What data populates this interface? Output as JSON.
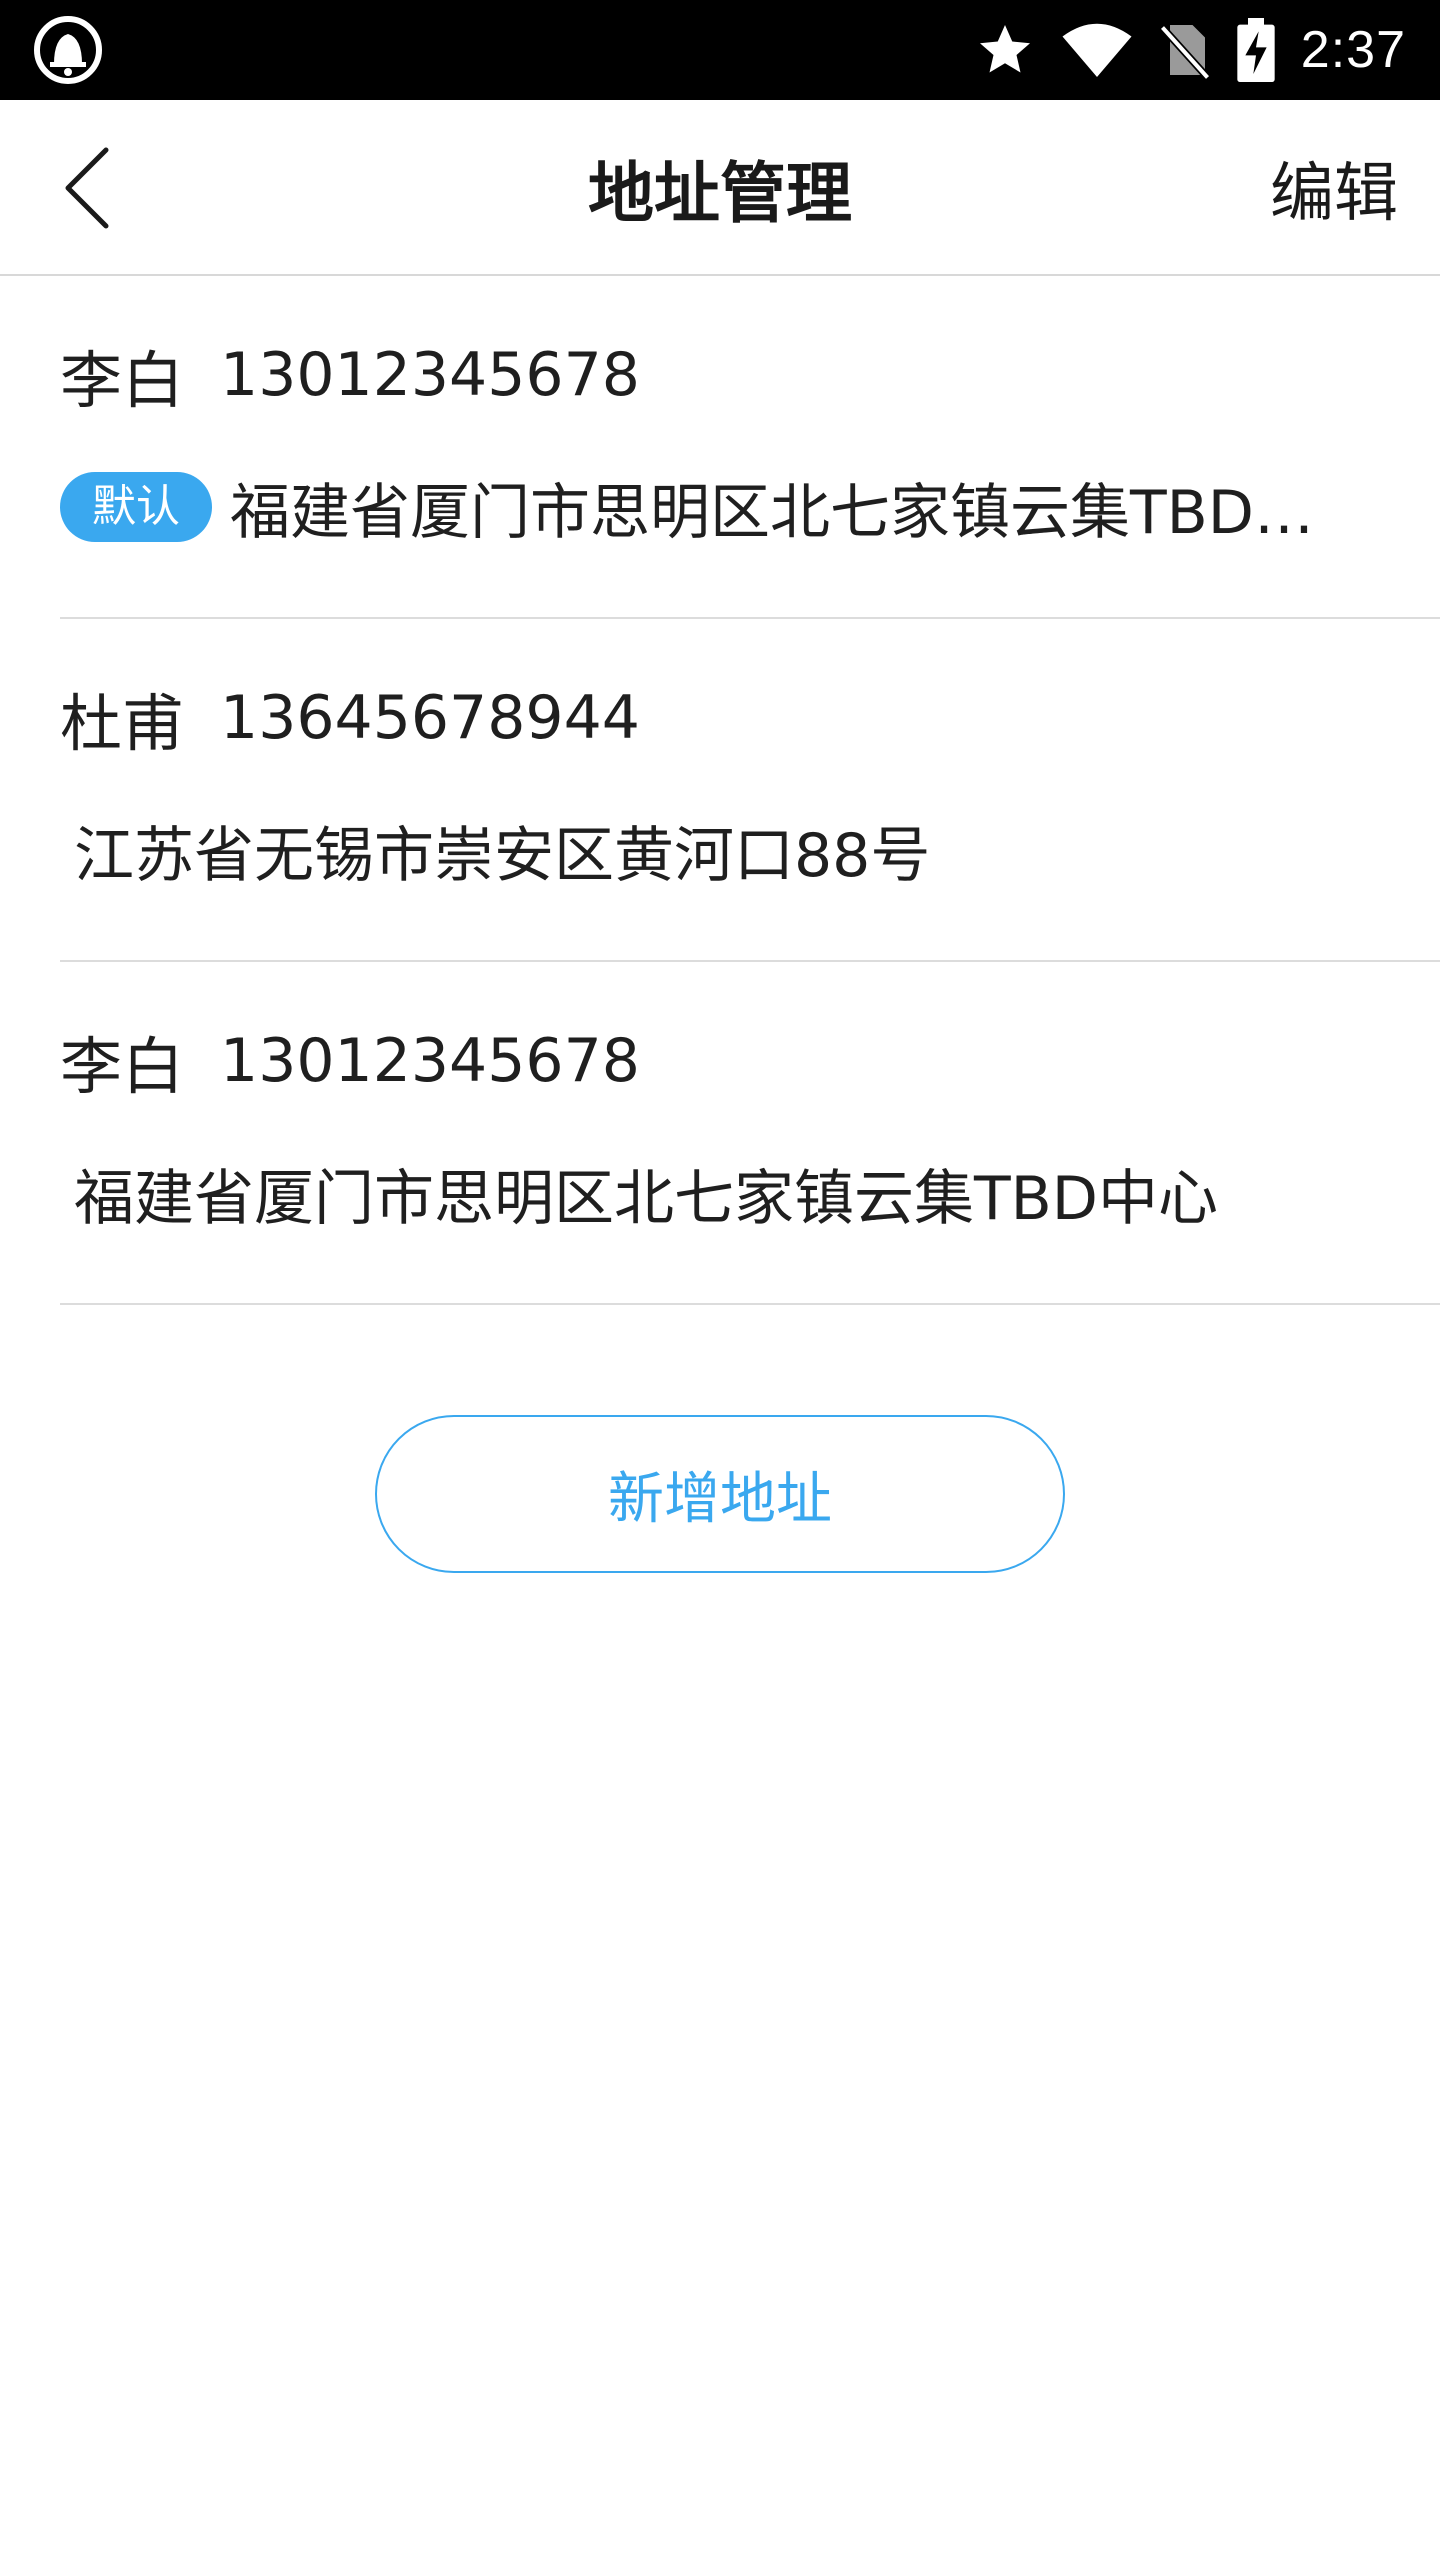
{
  "status_bar": {
    "time": "2:37",
    "icons": [
      "notification-bell-icon",
      "star-icon",
      "wifi-icon",
      "no-sim-icon",
      "battery-charging-icon"
    ]
  },
  "header": {
    "title": "地址管理",
    "edit_label": "编辑",
    "back_icon": "chevron-left-icon"
  },
  "addresses": [
    {
      "name": "李白",
      "phone": "13012345678",
      "badge": "默认",
      "address": "福建省厦门市思明区北七家镇云集TBD中心"
    },
    {
      "name": "杜甫",
      "phone": "13645678944",
      "badge": "",
      "address": "江苏省无锡市崇安区黄河口88号"
    },
    {
      "name": "李白",
      "phone": "13012345678",
      "badge": "",
      "address": "福建省厦门市思明区北七家镇云集TBD中心"
    }
  ],
  "add_button_label": "新增地址",
  "colors": {
    "accent": "#3aa8ef",
    "status_bar_bg": "#000000",
    "divider": "#dcdcdc",
    "text": "#1f1f1f"
  }
}
